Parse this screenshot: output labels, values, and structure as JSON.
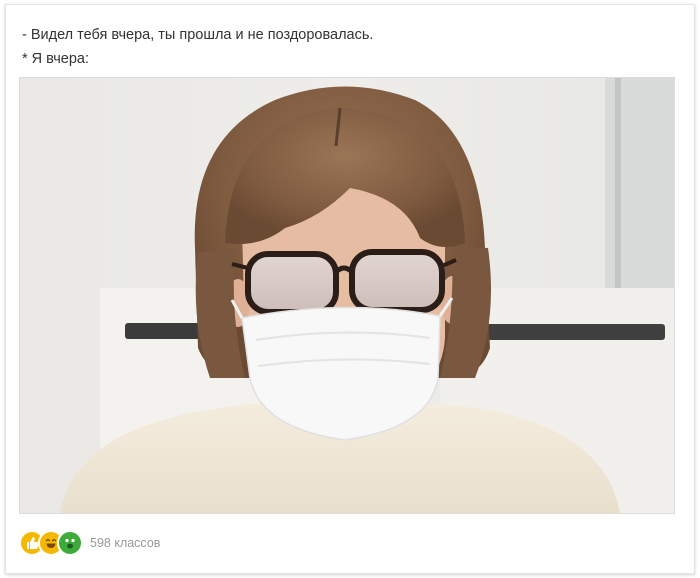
{
  "post": {
    "line1": "- Видел тебя вчера, ты прошла и не поздоровалась.",
    "line2": "* Я вчера:"
  },
  "reactions": {
    "icons": [
      "thumbs-up-emoji",
      "laughing-emoji",
      "wow-emoji"
    ],
    "count_label": "598 классов"
  },
  "colors": {
    "emoji_yellow": "#f5b800",
    "emoji_green": "#3daa3a",
    "count_text": "#999999"
  }
}
